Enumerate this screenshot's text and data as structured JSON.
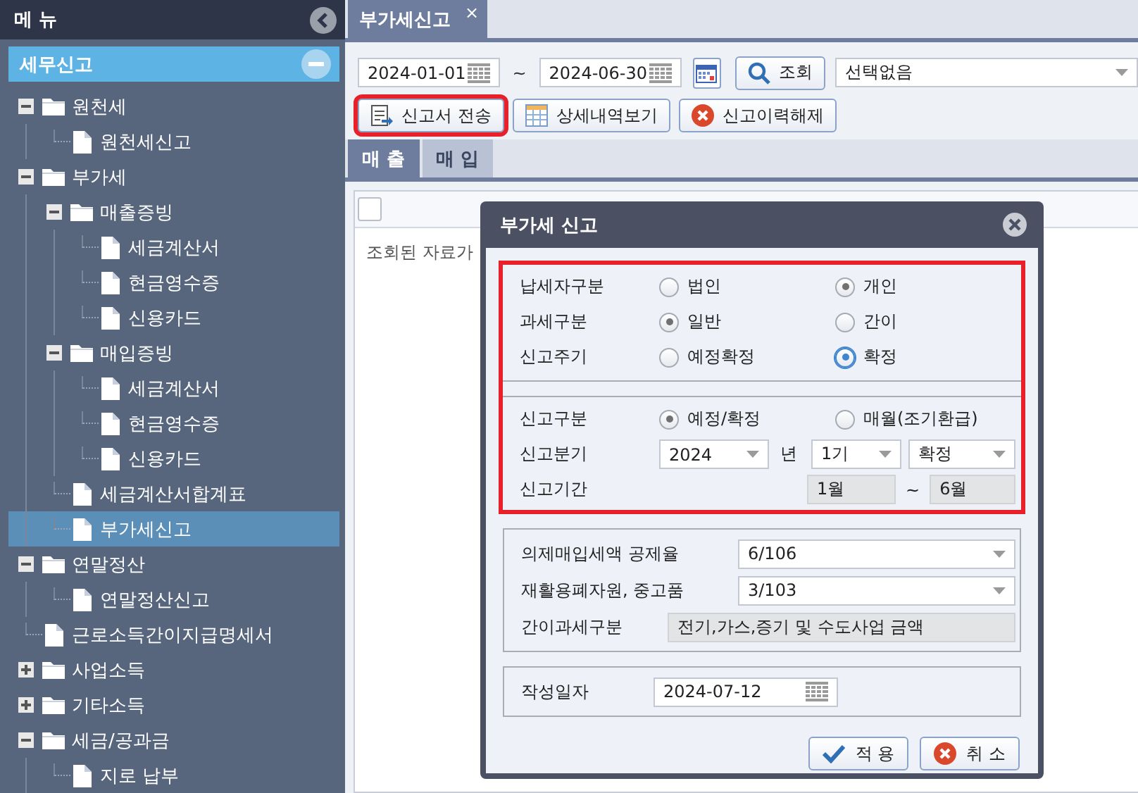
{
  "sidebar": {
    "title": "메 뉴",
    "section": {
      "label": "세무신고",
      "expanded": true
    },
    "tree": [
      {
        "label": "원천세",
        "kind": "folder",
        "expanded": true,
        "selected": false,
        "children": [
          {
            "label": "원천세신고",
            "kind": "doc",
            "selected": false
          }
        ]
      },
      {
        "label": "부가세",
        "kind": "folder",
        "expanded": true,
        "selected": false,
        "children": [
          {
            "label": "매출증빙",
            "kind": "folder",
            "expanded": true,
            "selected": false,
            "children": [
              {
                "label": "세금계산서",
                "kind": "doc",
                "selected": false
              },
              {
                "label": "현금영수증",
                "kind": "doc",
                "selected": false
              },
              {
                "label": "신용카드",
                "kind": "doc",
                "selected": false
              }
            ]
          },
          {
            "label": "매입증빙",
            "kind": "folder",
            "expanded": true,
            "selected": false,
            "children": [
              {
                "label": "세금계산서",
                "kind": "doc",
                "selected": false
              },
              {
                "label": "현금영수증",
                "kind": "doc",
                "selected": false
              },
              {
                "label": "신용카드",
                "kind": "doc",
                "selected": false
              }
            ]
          },
          {
            "label": "세금계산서합계표",
            "kind": "doc",
            "selected": false
          },
          {
            "label": "부가세신고",
            "kind": "doc",
            "selected": true
          }
        ]
      },
      {
        "label": "연말정산",
        "kind": "folder",
        "expanded": true,
        "selected": false,
        "children": [
          {
            "label": "연말정산신고",
            "kind": "doc",
            "selected": false
          }
        ]
      },
      {
        "label": "근로소득간이지급명세서",
        "kind": "doc",
        "selected": false
      },
      {
        "label": "사업소득",
        "kind": "folder",
        "expanded": false,
        "selected": false
      },
      {
        "label": "기타소득",
        "kind": "folder",
        "expanded": false,
        "selected": false
      },
      {
        "label": "세금/공과금",
        "kind": "folder",
        "expanded": true,
        "selected": false,
        "children": [
          {
            "label": "지로 납부",
            "kind": "doc",
            "selected": false
          }
        ]
      }
    ]
  },
  "tabs": [
    {
      "label": "부가세신고",
      "close": "×",
      "selected": true
    }
  ],
  "toolbar": {
    "date_from": "2024-01-01",
    "separator": "~",
    "date_to": "2024-06-30",
    "search_button": "조회",
    "filter": "선택없음"
  },
  "actions": [
    {
      "label": "신고서 전송",
      "kind": "send",
      "highlighted": true
    },
    {
      "label": "상세내역보기",
      "kind": "table",
      "highlighted": false
    },
    {
      "label": "신고이력해제",
      "kind": "cancel",
      "highlighted": false
    }
  ],
  "sub_tabs": [
    {
      "label": "매 출",
      "selected": true
    },
    {
      "label": "매 입",
      "selected": false
    }
  ],
  "grid": {
    "checked": false,
    "empty_message": "조회된 자료가"
  },
  "dialog": {
    "title": "부가세 신고",
    "highlighted": true,
    "taxpayer_rows": [
      {
        "label": "납세자구분",
        "kind": "radio",
        "options": [
          {
            "label": "법인",
            "selected": false,
            "focused": false
          },
          {
            "label": "개인",
            "selected": true,
            "focused": false
          }
        ]
      },
      {
        "label": "과세구분",
        "kind": "radio",
        "options": [
          {
            "label": "일반",
            "selected": true,
            "focused": false
          },
          {
            "label": "간이",
            "selected": false,
            "focused": false
          }
        ]
      },
      {
        "label": "신고주기",
        "kind": "radio",
        "options": [
          {
            "label": "예정확정",
            "selected": false,
            "focused": false
          },
          {
            "label": "확정",
            "selected": true,
            "focused": true
          }
        ]
      }
    ],
    "report_rows": [
      {
        "label": "신고구분",
        "kind": "radio",
        "options": [
          {
            "label": "예정/확정",
            "selected": true,
            "focused": false
          },
          {
            "label": "매월(조기환급)",
            "selected": false,
            "focused": false
          }
        ]
      },
      {
        "label": "신고분기",
        "kind": "selects",
        "year": "2024",
        "year_unit": "년",
        "half": "1기",
        "type": "확정"
      },
      {
        "label": "신고기간",
        "kind": "range",
        "from": "1월",
        "separator": "~",
        "to": "6월"
      }
    ],
    "rate_rows": [
      {
        "label": "의제매입세액 공제율",
        "kind": "select",
        "value": "6/106"
      },
      {
        "label": "재활용폐자원, 중고품",
        "kind": "select",
        "value": "3/103"
      },
      {
        "label": "간이과세구분",
        "kind": "readonly",
        "value": "전기,가스,증기 및 수도사업 금액"
      }
    ],
    "date": {
      "label": "작성일자",
      "value": "2024-07-12"
    },
    "buttons": [
      {
        "label": "적 용",
        "kind": "apply"
      },
      {
        "label": "취 소",
        "kind": "cancel"
      }
    ]
  }
}
